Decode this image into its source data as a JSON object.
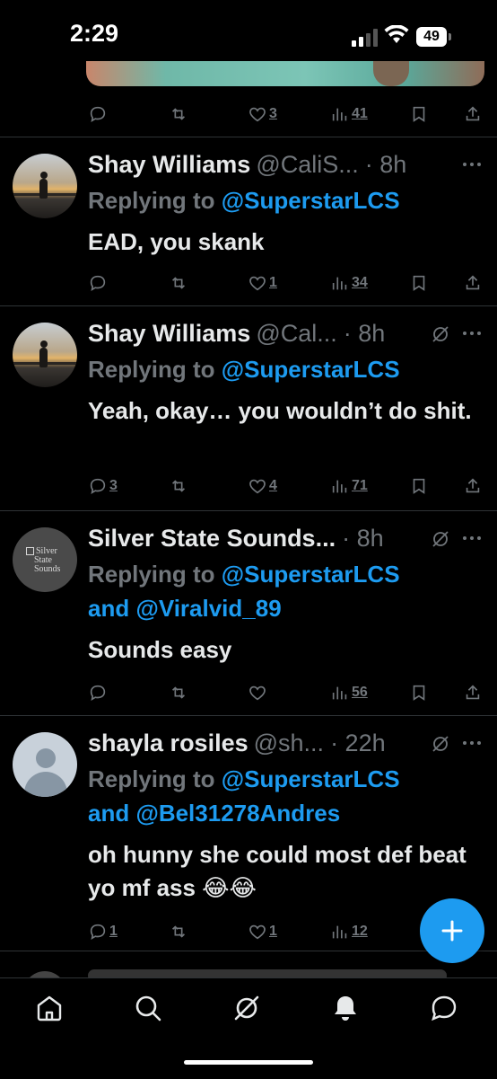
{
  "status_bar": {
    "time": "2:29",
    "battery": "49"
  },
  "tweets": [
    {
      "name": "Shay Williams",
      "handle": "@CaliS...",
      "time": "· 8h",
      "replying_label": "Replying to",
      "mention1": "@SuperstarLCS",
      "and_label": "",
      "mention2": "",
      "body": "EAD, you skank",
      "replies": "",
      "likes": "1",
      "views": "34"
    },
    {
      "name": "Shay Williams",
      "handle": "@Cal...",
      "time": "· 8h",
      "replying_label": "Replying to",
      "mention1": "@SuperstarLCS",
      "and_label": "",
      "mention2": "",
      "body": "Yeah, okay… you wouldn’t do shit.",
      "replies": "3",
      "likes": "4",
      "views": "71"
    },
    {
      "name": "Silver State Sounds...",
      "handle": "",
      "time": "· 8h",
      "replying_label": "Replying to",
      "mention1": "@SuperstarLCS",
      "and_label": "and",
      "mention2": "@Viralvid_89",
      "body": "Sounds easy",
      "replies": "",
      "likes": "",
      "views": "56",
      "avatar_logo": [
        "Silver",
        "State",
        "Sounds"
      ]
    },
    {
      "name": "shayla rosiles",
      "handle": "@sh...",
      "time": "· 22h",
      "replying_label": "Replying to",
      "mention1": "@SuperstarLCS",
      "and_label": "and",
      "mention2": "@Bel31278Andres",
      "body": "oh hunny she could most def beat yo mf ass 😂😂",
      "replies": "1",
      "likes": "1",
      "views": "12"
    }
  ],
  "top_actions": {
    "replies": "",
    "likes": "3",
    "views": "41"
  },
  "colors": {
    "background": "#000000",
    "accent": "#1d9bf0",
    "muted": "#71767b",
    "text": "#e7e9ea",
    "divider": "#2f3336"
  },
  "icons": {
    "reply": "reply-icon",
    "repost": "repost-icon",
    "like": "heart-icon",
    "views": "views-icon",
    "bookmark": "bookmark-icon",
    "share": "share-icon",
    "grok": "grok-icon",
    "more": "more-icon",
    "compose": "plus-icon"
  },
  "tabbar": [
    "home-icon",
    "search-icon",
    "grok-icon",
    "notifications-icon",
    "messages-icon"
  ]
}
